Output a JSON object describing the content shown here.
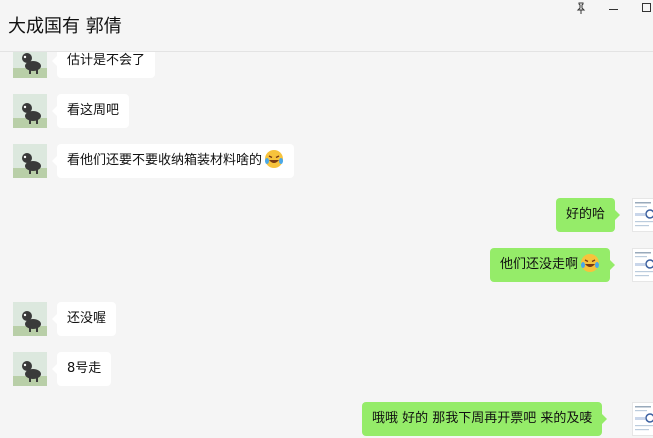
{
  "window": {
    "title": "大成国有 郭倩",
    "pin_icon": "pin-icon",
    "minimize_icon": "minimize-icon",
    "maximize_icon": "maximize-icon"
  },
  "messages": [
    {
      "side": "in",
      "text": "估计是不会了"
    },
    {
      "side": "in",
      "text": "看这周吧"
    },
    {
      "side": "in",
      "text": "看他们还要不要收纳箱装材料啥的",
      "emoji": "laugh-cry-emoji"
    },
    {
      "side": "out",
      "text": "好的哈"
    },
    {
      "side": "out",
      "text": "他们还没走啊",
      "emoji": "laugh-cry-emoji"
    },
    {
      "side": "in",
      "text": "还没喔"
    },
    {
      "side": "in",
      "text": "8号走"
    },
    {
      "side": "out",
      "text": "哦哦 好的 那我下周再开票吧 来的及唛"
    }
  ],
  "colors": {
    "background": "#f5f5f5",
    "incoming_bubble": "#ffffff",
    "outgoing_bubble": "#95ec69"
  }
}
